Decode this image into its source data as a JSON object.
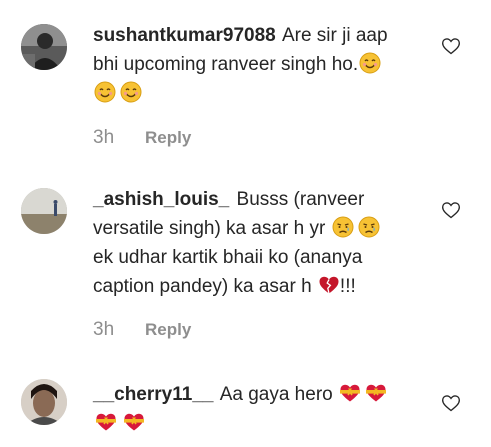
{
  "comments": [
    {
      "username": "sushantkumar97088",
      "text_line_a": "Are sir ji aap",
      "text_line_b": "bhi upcoming ranveer singh ho.",
      "emoji_names": [
        "smiling-face-icon",
        "smiling-face-icon",
        "smiling-face-icon"
      ],
      "time": "3h",
      "reply_label": "Reply"
    },
    {
      "username": "_ashish_louis_",
      "text_line_a": "Busss (ranveer",
      "text_line_b": "versatile singh) ka asar h yr",
      "text_line_c": "ek udhar kartik bhaii ko (ananya",
      "text_line_d": "caption pandey) ka asar h",
      "text_tail": "!!!",
      "emoji_names": [
        "sad-relieved-face-icon",
        "sad-relieved-face-icon",
        "broken-heart-icon"
      ],
      "time": "3h",
      "reply_label": "Reply"
    },
    {
      "username": "__cherry11__",
      "text_line_a": "Aa gaya hero",
      "emoji_names": [
        "heart-with-ribbon-icon",
        "heart-with-ribbon-icon",
        "heart-with-ribbon-icon",
        "heart-with-ribbon-icon"
      ]
    }
  ],
  "colors": {
    "text": "#262626",
    "secondary": "#8e8e8e",
    "heart_red": "#e0245e",
    "emoji_yellow": "#f7c234"
  }
}
